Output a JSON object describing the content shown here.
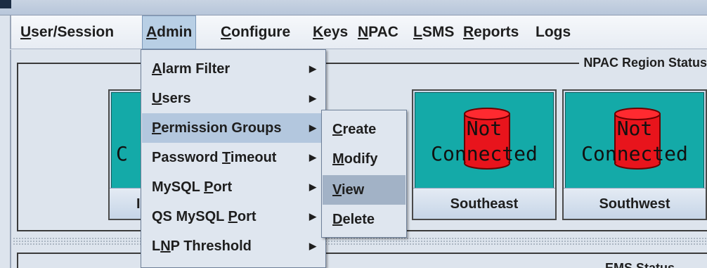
{
  "menubar": {
    "items": [
      {
        "before": "",
        "mnemonic": "U",
        "after": "ser/Session"
      },
      {
        "before": "",
        "mnemonic": "A",
        "after": "dmin"
      },
      {
        "before": "",
        "mnemonic": "C",
        "after": "onfigure"
      },
      {
        "before": "",
        "mnemonic": "K",
        "after": "eys"
      },
      {
        "before": "",
        "mnemonic": "N",
        "after": "PAC"
      },
      {
        "before": "",
        "mnemonic": "L",
        "after": "SMS"
      },
      {
        "before": "",
        "mnemonic": "R",
        "after": "eports"
      },
      {
        "before": "Lo",
        "mnemonic": "g",
        "after": "s"
      }
    ]
  },
  "admin_menu": {
    "items": [
      {
        "before": "",
        "mnemonic": "A",
        "after": "larm Filter"
      },
      {
        "before": "",
        "mnemonic": "U",
        "after": "sers"
      },
      {
        "before": "",
        "mnemonic": "P",
        "after": "ermission Groups"
      },
      {
        "before": "Password ",
        "mnemonic": "T",
        "after": "imeout"
      },
      {
        "before": "MySQL ",
        "mnemonic": "P",
        "after": "ort"
      },
      {
        "before": "QS MySQL ",
        "mnemonic": "P",
        "after": "ort"
      },
      {
        "before": "L",
        "mnemonic": "N",
        "after": "P Threshold"
      }
    ],
    "arrow": "▶"
  },
  "permission_submenu": {
    "items": [
      {
        "mnemonic": "C",
        "after": "reate"
      },
      {
        "mnemonic": "M",
        "after": "odify"
      },
      {
        "mnemonic": "V",
        "after": "iew"
      },
      {
        "mnemonic": "D",
        "after": "elete"
      }
    ]
  },
  "npac_region_status": {
    "title": "NPAC Region Status",
    "regions": [
      {
        "name": "",
        "partial_text": "C"
      },
      {
        "name": "Southeast",
        "line1": "Not",
        "line2": "Connected"
      },
      {
        "name": "Southwest",
        "line1": "Not",
        "line2": "Connected"
      }
    ],
    "hidden_label_fragment": "I"
  },
  "ems_status": {
    "title": "EMS Status"
  },
  "colors": {
    "card_face": "#14aaa8",
    "drum": "#e8141c",
    "highlight": "#b3c7de"
  }
}
